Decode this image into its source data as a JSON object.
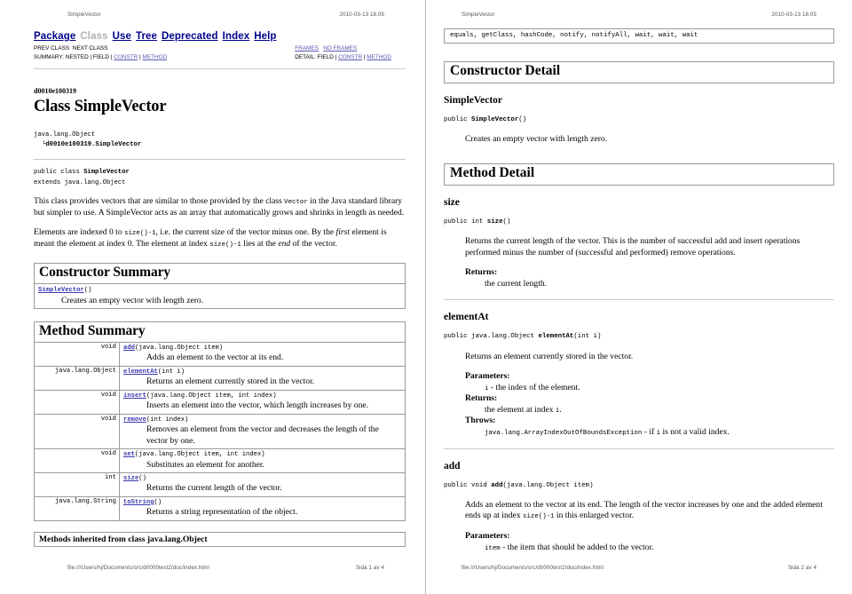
{
  "document": {
    "running_head_title": "SimpleVector",
    "running_head_date": "2010-03-13 18.05",
    "footer_path": "file:///Users/hj/Documents/src/d0000test2/doc/index.html"
  },
  "page_left": {
    "footer_page": "Sida 1 av 4",
    "navbar": {
      "links": [
        {
          "label": "Package",
          "state": "link"
        },
        {
          "label": "Class",
          "state": "disabled"
        },
        {
          "label": "Use",
          "state": "link"
        },
        {
          "label": "Tree",
          "state": "link"
        },
        {
          "label": "Deprecated",
          "state": "link"
        },
        {
          "label": "Index",
          "state": "link"
        },
        {
          "label": "Help",
          "state": "link"
        }
      ],
      "prev_class": "PREV CLASS",
      "next_class": "NEXT CLASS",
      "summary_label": "SUMMARY:",
      "summary_nested": "NESTED",
      "summary_field": "FIELD",
      "summary_constr": "CONSTR",
      "summary_method": "METHOD",
      "frames": "FRAMES",
      "no_frames": "NO FRAMES",
      "detail_label": "DETAIL:",
      "detail_field": "FIELD",
      "detail_constr": "CONSTR",
      "detail_method": "METHOD",
      "separator": "|"
    },
    "package_name": "d0010e100319",
    "class_title": "Class SimpleVector",
    "hierarchy": {
      "root": "java.lang.Object",
      "child_prefix": "└",
      "child": "d0010e100319.SimpleVector"
    },
    "declaration": {
      "line1_prefix": "public class ",
      "line1_name": "SimpleVector",
      "line2": "extends java.lang.Object"
    },
    "description": {
      "p1_a": "This class provides vectors that are similar to those provided by the class ",
      "p1_code": "Vector",
      "p1_b": " in the Java standard library but simpler to use. A SimpleVector acts as an array that automatically grows and shrinks in length as needed.",
      "p2_a": "Elements are indexed 0 to ",
      "p2_code1": "size()-1",
      "p2_b": ", i.e. the current size of the vector minus one. By the ",
      "p2_em1": "first",
      "p2_c": " element is meant the element at index 0. The element at index ",
      "p2_code2": "size()-1",
      "p2_d": " lies at the ",
      "p2_em2": "end",
      "p2_e": " of the vector."
    },
    "constructor_summary": {
      "heading": "Constructor Summary",
      "rows": [
        {
          "link": "SimpleVector",
          "args": "()",
          "desc": "Creates an empty vector with length zero."
        }
      ]
    },
    "method_summary": {
      "heading": "Method Summary",
      "rows": [
        {
          "return_type": "void",
          "link": "add",
          "args": "(java.lang.Object item)",
          "desc": "Adds an element to the vector at its end."
        },
        {
          "return_type": "java.lang.Object",
          "link": "elementAt",
          "args": "(int i)",
          "desc": "Returns an element currently stored in the vector."
        },
        {
          "return_type": "void",
          "link": "insert",
          "args": "(java.lang.Object item, int index)",
          "desc": "Inserts an element into the vector, which length increases by one."
        },
        {
          "return_type": "void",
          "link": "remove",
          "args": "(int index)",
          "desc": "Removes an element from the vector and decreases the length of the vector by one."
        },
        {
          "return_type": "void",
          "link": "set",
          "args": "(java.lang.Object item, int index)",
          "desc": "Substitutes an element for another."
        },
        {
          "return_type": "int",
          "link": "size",
          "args": "()",
          "desc": "Returns the current length of the vector."
        },
        {
          "return_type": "java.lang.String",
          "link": "toString",
          "args": "()",
          "desc": "Returns a string representation of the object."
        }
      ]
    },
    "inherited": {
      "heading": "Methods inherited from class java.lang.Object"
    }
  },
  "page_right": {
    "footer_page": "Sida 2 av 4",
    "inherited_members": "equals, getClass, hashCode, notify, notifyAll, wait, wait, wait",
    "constructor_detail": {
      "heading": "Constructor Detail",
      "name": "SimpleVector",
      "sig_prefix": "public ",
      "sig_name": "SimpleVector",
      "sig_args": "()",
      "desc": "Creates an empty vector with length zero."
    },
    "method_detail": {
      "heading": "Method Detail",
      "methods": [
        {
          "name": "size",
          "sig_prefix": "public int ",
          "sig_name": "size",
          "sig_args": "()",
          "desc": "Returns the current length of the vector. This is the number of successful add and insert operations performed minus the number of (successful and performed) remove operations.",
          "sections": [
            {
              "title": "Returns:",
              "items": [
                {
                  "text": "the current length."
                }
              ]
            }
          ]
        },
        {
          "name": "elementAt",
          "sig_prefix": "public java.lang.Object ",
          "sig_name": "elementAt",
          "sig_args": "(int i)",
          "desc": "Returns an element currently stored in the vector.",
          "sections": [
            {
              "title": "Parameters:",
              "items": [
                {
                  "code": "i",
                  "text": " - the index of the element."
                }
              ]
            },
            {
              "title": "Returns:",
              "items": [
                {
                  "text": "the element at index ",
                  "code_after": "i",
                  "text_after": "."
                }
              ]
            },
            {
              "title": "Throws:",
              "items": [
                {
                  "code": "java.lang.ArrayIndexOutOfBoundsException",
                  "text": " - if ",
                  "code_after": "i",
                  "text_after": " is not a valid index."
                }
              ]
            }
          ]
        },
        {
          "name": "add",
          "sig_prefix": "public void ",
          "sig_name": "add",
          "sig_args": "(java.lang.Object item)",
          "desc_a": "Adds an element to the vector at its end. The length of the vector increases by one and the added element ends up at index ",
          "desc_code": "size()-1",
          "desc_b": " in this enlarged vector.",
          "sections": [
            {
              "title": "Parameters:",
              "items": [
                {
                  "code": "item",
                  "text": " - the item that should be added to the vector."
                }
              ]
            }
          ]
        }
      ]
    }
  }
}
